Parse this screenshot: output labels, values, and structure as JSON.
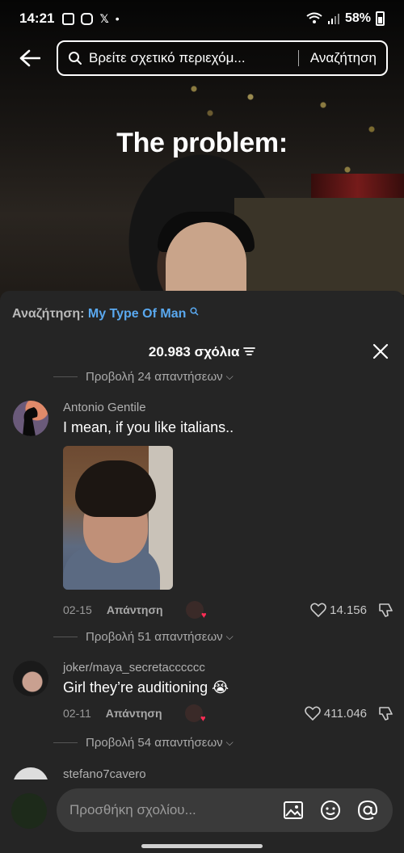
{
  "status_bar": {
    "time": "14:21",
    "battery": "58%"
  },
  "top_bar": {
    "query": "Βρείτε σχετικό περιεχόμ...",
    "search_label": "Αναζήτηση"
  },
  "video": {
    "caption": "The problem:"
  },
  "comments": {
    "suggestion_prefix": "Αναζήτηση:",
    "suggestion_term": "My Type Of Man",
    "count_label": "20.983 σχόλια",
    "view_replies_top": "Προβολή 24 απαντήσεων",
    "items": [
      {
        "username": "Antonio Gentile",
        "text": "I mean, if you like italians..",
        "date": "02-15",
        "reply_label": "Απάντηση",
        "likes": "14.156",
        "view_replies": "Προβολή 51 απαντήσεων"
      },
      {
        "username": "joker/maya_secretacccccc",
        "text": "Girl they’re auditioning 😭",
        "date": "02-11",
        "reply_label": "Απάντηση",
        "likes": "411.046",
        "view_replies": "Προβολή 54 απαντήσεων"
      },
      {
        "username": "stefano7cavero"
      }
    ]
  },
  "input": {
    "placeholder": "Προσθήκη σχολίου..."
  },
  "colors": {
    "panel_bg": "#252525",
    "accent_link": "#5aa9f0",
    "heart_red": "#ff2d55"
  }
}
